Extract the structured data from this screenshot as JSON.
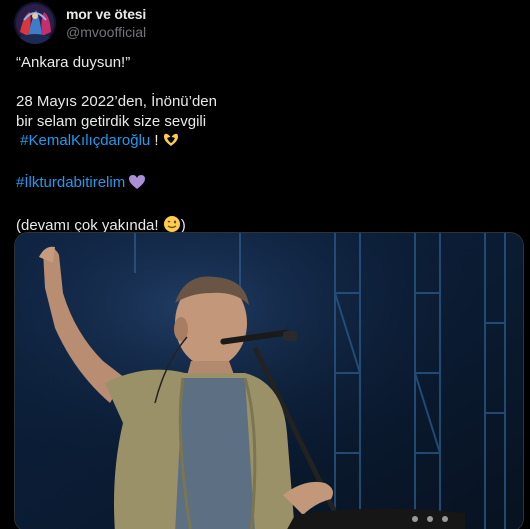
{
  "author": {
    "display_name": "mor ve ötesi",
    "handle": "@mvoofficial",
    "avatar_icon": "band-avatar-icon"
  },
  "tweet": {
    "line1": "“Ankara duysun!”",
    "line2": "28 Mayıs 2022’den, İnönü’den",
    "line3": "bir selam getirdik size sevgili",
    "hashtag1": "#KemalKılıçdaroğlu",
    "hashtag1_suffix": " !",
    "hashtag2": "#İlkturdabitirelim",
    "line_last": "(devamı çok yakında! ",
    "line_last_end": ")"
  },
  "emojis": {
    "heart_hands": "heart-hands-icon",
    "purple_heart": "purple-heart-icon",
    "wink": "winking-face-icon"
  },
  "media": {
    "description_icon": "concert-photo-image"
  },
  "colors": {
    "background": "#000000",
    "text": "#e7e9ea",
    "secondary_text": "#71767b",
    "link": "#1d9bf0",
    "border": "#2f3336",
    "purple": "#aa8ed6",
    "emoji_yellow": "#ffcc4d"
  }
}
